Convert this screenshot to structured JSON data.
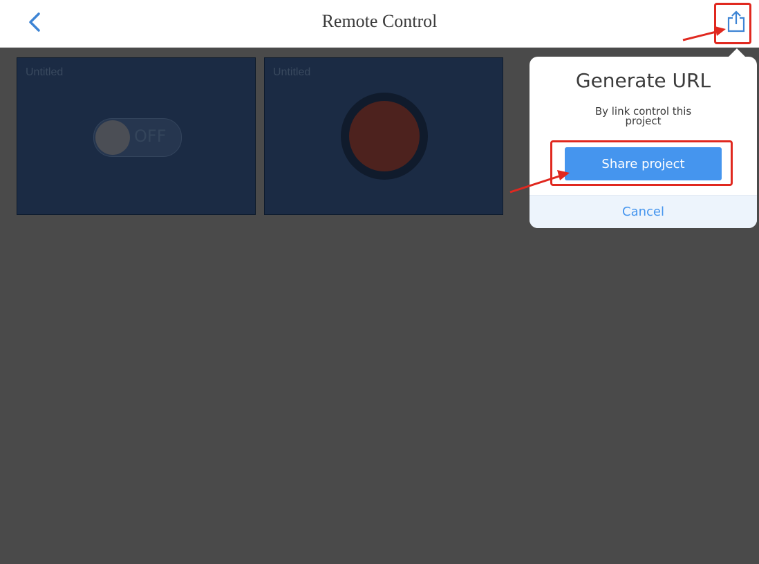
{
  "header": {
    "title": "Remote Control",
    "back_icon": "chevron-left-icon",
    "share_icon": "share-upload-icon"
  },
  "widgets": [
    {
      "title": "Untitled",
      "type": "switch",
      "state_label": "OFF"
    },
    {
      "title": "Untitled",
      "type": "push-button",
      "color": "#4d221e"
    }
  ],
  "popup": {
    "title": "Generate URL",
    "subtitle": "By link control this project",
    "share_label": "Share project",
    "cancel_label": "Cancel"
  },
  "colors": {
    "accent": "#4595ee",
    "annotation": "#e0281f",
    "dim_background": "#4a4a4a",
    "widget_background": "#1b2b44"
  }
}
